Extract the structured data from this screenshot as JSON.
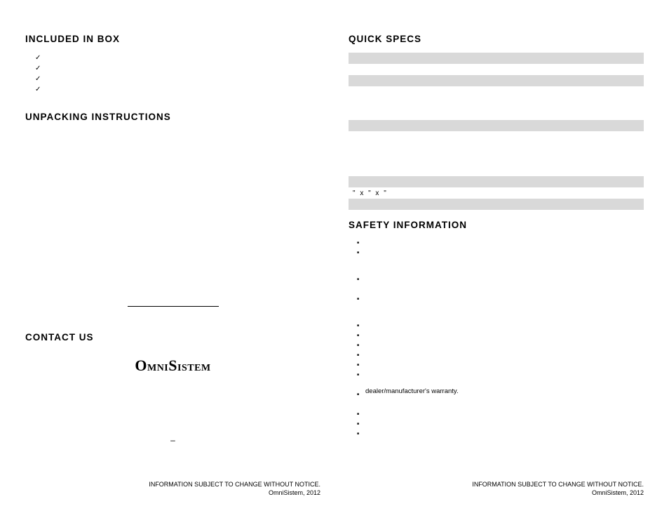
{
  "left": {
    "included_title": "INCLUDED IN BOX",
    "unpacking_title": "UNPACKING INSTRUCTIONS",
    "contact_title": "CONTACT US",
    "logo_text": "OmniSistem",
    "dash": "–"
  },
  "right": {
    "specs_title": "QUICK SPECS",
    "dims": "\" x     \" x   \"",
    "safety_title": "SAFETY INFORMATION",
    "warranty_line": "dealer/manufacturer's warranty."
  },
  "footer": {
    "line1": "INFORMATION SUBJECT TO CHANGE WITHOUT NOTICE.",
    "line2": "OmniSistem, 2012"
  }
}
